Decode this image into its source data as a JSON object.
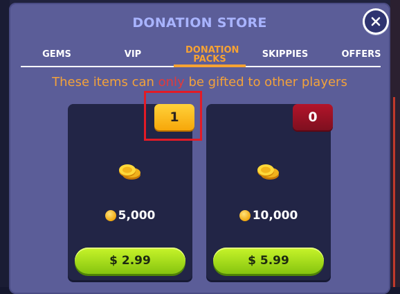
{
  "store": {
    "title": "DONATION STORE",
    "notice_before": "These items can ",
    "notice_only": "only",
    "notice_after": " be gifted to other players"
  },
  "tabs": [
    {
      "label": "GEMS",
      "active": false
    },
    {
      "label": "VIP",
      "active": false
    },
    {
      "label": "DONATION PACKS",
      "active": true
    },
    {
      "label": "SKIPPIES",
      "active": false
    },
    {
      "label": "OFFERS",
      "active": false
    }
  ],
  "packs": [
    {
      "count": "1",
      "amount": "5,000",
      "price": "$ 2.99",
      "badge_color": "#f7a70a"
    },
    {
      "count": "0",
      "amount": "10,000",
      "price": "$ 5.99",
      "badge_color": "#9a1224"
    }
  ],
  "icons": {
    "close": "close-icon",
    "coins": "coin-stack-icon",
    "coin": "coin-icon"
  }
}
